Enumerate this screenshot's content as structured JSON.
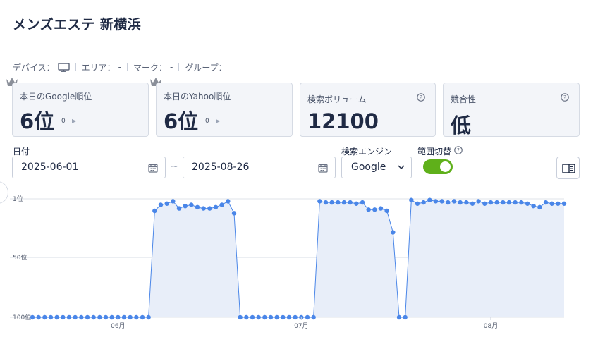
{
  "page": {
    "title": "メンズエステ 新横浜"
  },
  "filters": [
    {
      "label": "デバイス：",
      "value": "",
      "icon": "monitor-icon"
    },
    {
      "label": "エリア：",
      "value": "-"
    },
    {
      "label": "マーク：",
      "value": "-"
    },
    {
      "label": "グループ：",
      "value": ""
    }
  ],
  "cards": {
    "google": {
      "label": "本日のGoogle順位",
      "value": "6位",
      "change": "0"
    },
    "yahoo": {
      "label": "本日のYahoo順位",
      "value": "6位",
      "change": "0"
    },
    "volume": {
      "label": "検索ボリューム",
      "value": "12100"
    },
    "competition": {
      "label": "競合性",
      "value": "低"
    }
  },
  "form": {
    "date_label": "日付",
    "start_date": "2025-06-01",
    "tilde": "~",
    "end_date": "2025-08-26",
    "engine_label": "検索エンジン",
    "engine_value": "Google",
    "toggle_label": "範囲切替",
    "toggle_on": true
  },
  "colors": {
    "line": "#4a86e8",
    "area": "#e8eef9",
    "toggle": "#5fb01a",
    "title": "#1f2a44"
  },
  "chart_data": {
    "type": "area",
    "y_axis": {
      "reversed": true,
      "min": 1,
      "max": 100,
      "ticks": [
        1,
        50,
        100
      ],
      "tick_labels": [
        "1位",
        "50位",
        "100位"
      ]
    },
    "x_tick_labels": [
      {
        "label": "06月",
        "index": 14
      },
      {
        "label": "07月",
        "index": 44
      },
      {
        "label": "08月",
        "index": 75
      }
    ],
    "grid": true,
    "x_start": "2025-05-18",
    "series": [
      {
        "values": [
          100,
          100,
          100,
          100,
          100,
          100,
          100,
          100,
          100,
          100,
          100,
          100,
          100,
          100,
          100,
          100,
          100,
          100,
          100,
          100,
          11,
          6,
          5,
          3,
          9,
          7,
          6,
          8,
          9,
          9,
          8,
          6,
          3,
          13,
          100,
          100,
          100,
          100,
          100,
          100,
          100,
          100,
          100,
          100,
          100,
          100,
          100,
          3,
          4,
          4,
          4,
          4,
          4,
          5,
          4,
          10,
          10,
          9,
          11,
          29,
          100,
          100,
          2,
          5,
          4,
          2,
          3,
          3,
          4,
          3,
          4,
          4,
          5,
          3,
          5,
          4,
          4,
          4,
          4,
          4,
          4,
          5,
          7,
          8,
          4,
          5,
          5,
          5
        ]
      }
    ]
  }
}
